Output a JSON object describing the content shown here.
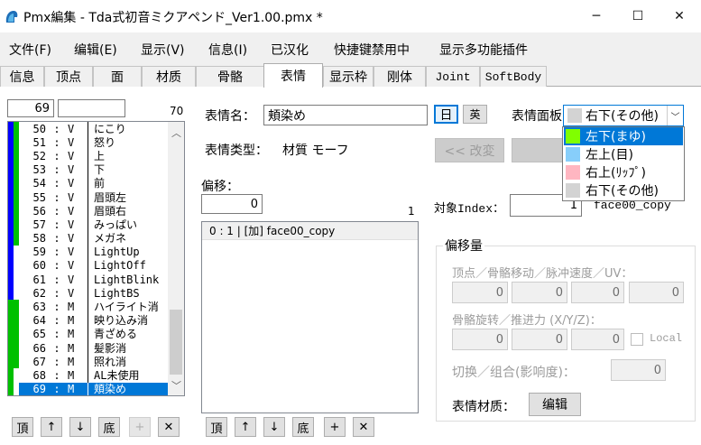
{
  "window": {
    "title": "Pmx編集 - Tda式初音ミクアペンド_Ver1.00.pmx *",
    "minimize": "─",
    "maximize": "☐",
    "close": "✕"
  },
  "menu": [
    "文件(F)",
    "编辑(E)",
    "显示(V)",
    "信息(I)",
    "已汉化",
    "快捷键禁用中",
    "显示多功能插件"
  ],
  "tabs": [
    "信息",
    "顶点",
    "面",
    "材质",
    "骨骼",
    "表情",
    "显示枠",
    "刚体",
    "Joint",
    "SoftBody"
  ],
  "list_panel": {
    "index_value": "69",
    "name_value": "",
    "count": "70"
  },
  "morph_list": [
    {
      "n": "50",
      "c": "V",
      "name": "にこり",
      "c1": "#0000ff",
      "c2": "#00c000",
      "sel": false
    },
    {
      "n": "51",
      "c": "V",
      "name": "怒り",
      "c1": "#0000ff",
      "c2": "#00c000",
      "sel": false
    },
    {
      "n": "52",
      "c": "V",
      "name": "上",
      "c1": "#0000ff",
      "c2": "#00c000",
      "sel": false
    },
    {
      "n": "53",
      "c": "V",
      "name": "下",
      "c1": "#0000ff",
      "c2": "#00c000",
      "sel": false
    },
    {
      "n": "54",
      "c": "V",
      "name": "前",
      "c1": "#0000ff",
      "c2": "#00c000",
      "sel": false
    },
    {
      "n": "55",
      "c": "V",
      "name": "眉頭左",
      "c1": "#0000ff",
      "c2": "#00c000",
      "sel": false
    },
    {
      "n": "56",
      "c": "V",
      "name": "眉頭右",
      "c1": "#0000ff",
      "c2": "#00c000",
      "sel": false
    },
    {
      "n": "57",
      "c": "V",
      "name": "みっぱい",
      "c1": "#0000ff",
      "c2": "#00c000",
      "sel": false
    },
    {
      "n": "58",
      "c": "V",
      "name": "メガネ",
      "c1": "#0000ff",
      "c2": "#00c000",
      "sel": false
    },
    {
      "n": "59",
      "c": "V",
      "name": "LightUp",
      "c1": "#0000ff",
      "c2": "#ffffff",
      "sel": false
    },
    {
      "n": "60",
      "c": "V",
      "name": "LightOff",
      "c1": "#0000ff",
      "c2": "#ffffff",
      "sel": false
    },
    {
      "n": "61",
      "c": "V",
      "name": "LightBlink",
      "c1": "#0000ff",
      "c2": "#ffffff",
      "sel": false
    },
    {
      "n": "62",
      "c": "V",
      "name": "LightBS",
      "c1": "#0000ff",
      "c2": "#ffffff",
      "sel": false
    },
    {
      "n": "63",
      "c": "M",
      "name": "ハイライト消",
      "c1": "#00c000",
      "c2": "#00c000",
      "sel": false
    },
    {
      "n": "64",
      "c": "M",
      "name": "映り込み消",
      "c1": "#00c000",
      "c2": "#00c000",
      "sel": false
    },
    {
      "n": "65",
      "c": "M",
      "name": "青ざめる",
      "c1": "#00c000",
      "c2": "#00c000",
      "sel": false
    },
    {
      "n": "66",
      "c": "M",
      "name": "髪影消",
      "c1": "#00c000",
      "c2": "#00c000",
      "sel": false
    },
    {
      "n": "67",
      "c": "M",
      "name": "照れ消",
      "c1": "#00c000",
      "c2": "#00c000",
      "sel": false
    },
    {
      "n": "68",
      "c": "M",
      "name": "AL未使用",
      "c1": "#00c000",
      "c2": "#ffffff",
      "sel": false
    },
    {
      "n": "69",
      "c": "M",
      "name": "頬染め",
      "c1": "#00c000",
      "c2": "#ffffff",
      "sel": true
    }
  ],
  "list_buttons": {
    "top": "頂",
    "up": "↑",
    "down": "↓",
    "bottom": "底",
    "add": "+",
    "delete": "✕"
  },
  "detail": {
    "name_label": "表情名：",
    "name_value": "頬染め",
    "lang_jp": "日",
    "lang_en": "英",
    "type_label": "表情类型：",
    "type_value": "材質 モーフ",
    "panel_label": "表情面板",
    "panel_selected": "右下(その他)",
    "panel_selected_color": "#d3d3d3",
    "panel_options": [
      {
        "label": "左下(まゆ)",
        "color": "#80ff00",
        "highlight": true
      },
      {
        "label": "左上(目)",
        "color": "#87cefa",
        "highlight": false
      },
      {
        "label": "右上(ﾘｯﾌﾟ)",
        "color": "#ffb6c1",
        "highlight": false
      },
      {
        "label": "右下(その他)",
        "color": "#d3d3d3",
        "highlight": false
      }
    ],
    "change_button": "<< 改変",
    "offset_label": "偏移：",
    "offset_value": "0",
    "offset_count": "1",
    "offset_items": [
      "0 : 1 | [加] face00_copy"
    ],
    "target_label": "対象Index：",
    "target_value": "1",
    "target_name": "face00_copy"
  },
  "offset_buttons": {
    "top": "頂",
    "up": "↑",
    "down": "↓",
    "bottom": "底",
    "add": "+",
    "delete": "✕"
  },
  "offset_group": {
    "title": "偏移量",
    "vertex_label": "顶点／骨骼移动／脉冲速度／UV：",
    "vertex_values": [
      "0",
      "0",
      "0",
      "0"
    ],
    "rotation_label": "骨骼旋转／推进力 (X/Y/Z)：",
    "rotation_values": [
      "0",
      "0",
      "0"
    ],
    "local_label": "Local",
    "switch_label": "切换／组合(影响度)：",
    "switch_value": "0",
    "material_label": "表情材质：",
    "edit_button": "编辑"
  }
}
